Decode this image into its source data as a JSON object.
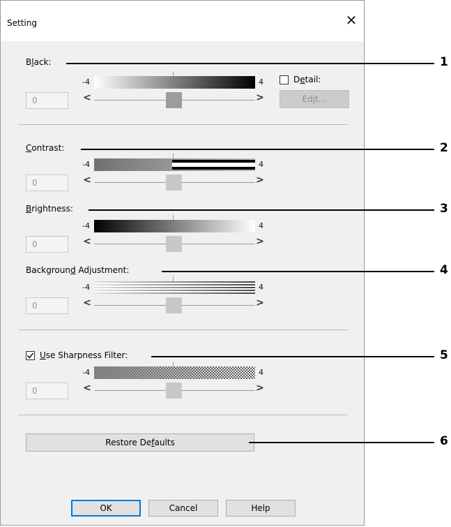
{
  "dialog": {
    "title": "Setting",
    "close_symbol": "✕"
  },
  "sections": [
    {
      "label_pre": "B",
      "label_u": "l",
      "label_post": "ack:",
      "min": "-4",
      "max": "4",
      "value": "0",
      "left": "<",
      "right": ">"
    },
    {
      "label_pre": "",
      "label_u": "C",
      "label_post": "ontrast:",
      "min": "-4",
      "max": "4",
      "value": "0",
      "left": "<",
      "right": ">"
    },
    {
      "label_pre": "",
      "label_u": "B",
      "label_post": "rightness:",
      "min": "-4",
      "max": "4",
      "value": "0",
      "left": "<",
      "right": ">"
    },
    {
      "label_pre": "Backgroun",
      "label_u": "d",
      "label_post": " Adjustment:",
      "min": "-4",
      "max": "4",
      "value": "0",
      "left": "<",
      "right": ">"
    },
    {
      "label_pre": "",
      "label_u": "U",
      "label_post": "se Sharpness Filter:",
      "min": "-4",
      "max": "4",
      "value": "0",
      "left": "<",
      "right": ">",
      "checked": true
    }
  ],
  "detail": {
    "label_pre": "D",
    "label_u": "e",
    "label_post": "tail:",
    "checked": false,
    "edit_pre": "Ed",
    "edit_u": "i",
    "edit_post": "t..."
  },
  "restore": {
    "label_pre": "Restore De",
    "label_u": "f",
    "label_post": "aults"
  },
  "buttons": {
    "ok": "OK",
    "cancel": "Cancel",
    "help": "Help"
  },
  "callouts": [
    "1",
    "2",
    "3",
    "4",
    "5",
    "6"
  ]
}
